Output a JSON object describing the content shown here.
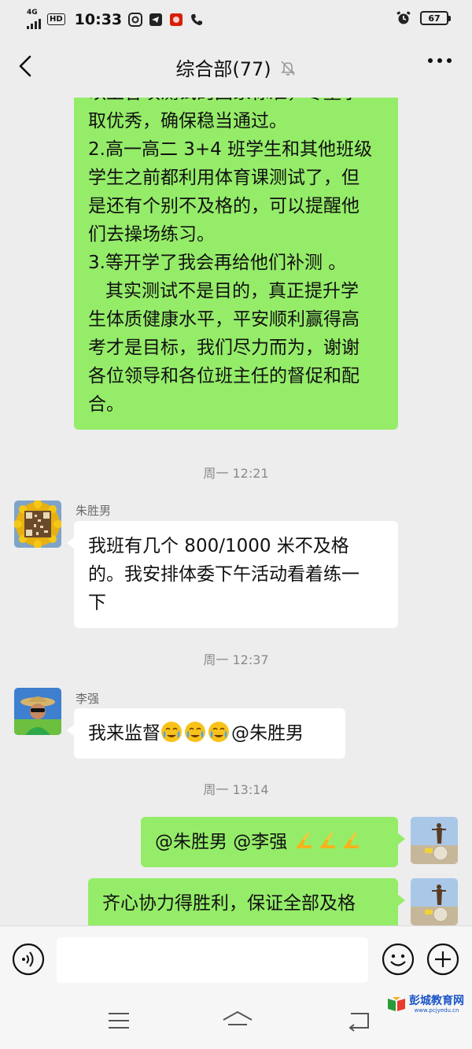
{
  "status_bar": {
    "network": "4G",
    "hd": "HD",
    "time": "10:33",
    "battery": "67"
  },
  "header": {
    "title": "综合部(77)"
  },
  "messages": {
    "long_message_lines": [
      "以上各项测试的国家标准，尽量争",
      "取优秀，确保稳当通过。",
      "2.高一高二 3+4 班学生和其他班级",
      "学生之前都利用体育课测试了，但",
      "是还有个别不及格的，可以提醒他",
      "们去操场练习。",
      "3.等开学了我会再给他们补测 。",
      "   其实测试不是目的，真正提升学",
      "生体质健康水平，平安顺利赢得高",
      "考才是目标，我们尽力而为，谢谢",
      "各位领导和各位班主任的督促和配",
      "合。"
    ],
    "ts1": "周一 12:21",
    "msg1_sender": "朱胜男",
    "msg1_lines": [
      "我班有几个 800/1000 米不及格",
      "的。我安排体委下午活动看着练一",
      "下"
    ],
    "ts2": "周一 12:37",
    "msg2_sender": "李强",
    "msg2_prefix": "我来监督",
    "msg2_suffix": "@朱胜男",
    "ts3": "周一 13:14",
    "msg3_text": "@朱胜男  @李强 ",
    "msg4_text": "齐心协力得胜利，保证全部及格"
  },
  "watermark": {
    "name": "彭城教育网",
    "url": "www.pcjyedu.cn"
  },
  "colors": {
    "background": "#ededed",
    "green_bubble": "#95ec69",
    "white_bubble": "#ffffff",
    "watermark_blue": "#1a55c7"
  },
  "icons": [
    "back-arrow-icon",
    "mute-bell-icon",
    "more-icon",
    "voice-icon",
    "emoji-icon",
    "plus-icon",
    "menu-nav-icon",
    "home-nav-icon",
    "back-nav-icon",
    "crying-emoji-icon",
    "praying-hands-icon"
  ]
}
